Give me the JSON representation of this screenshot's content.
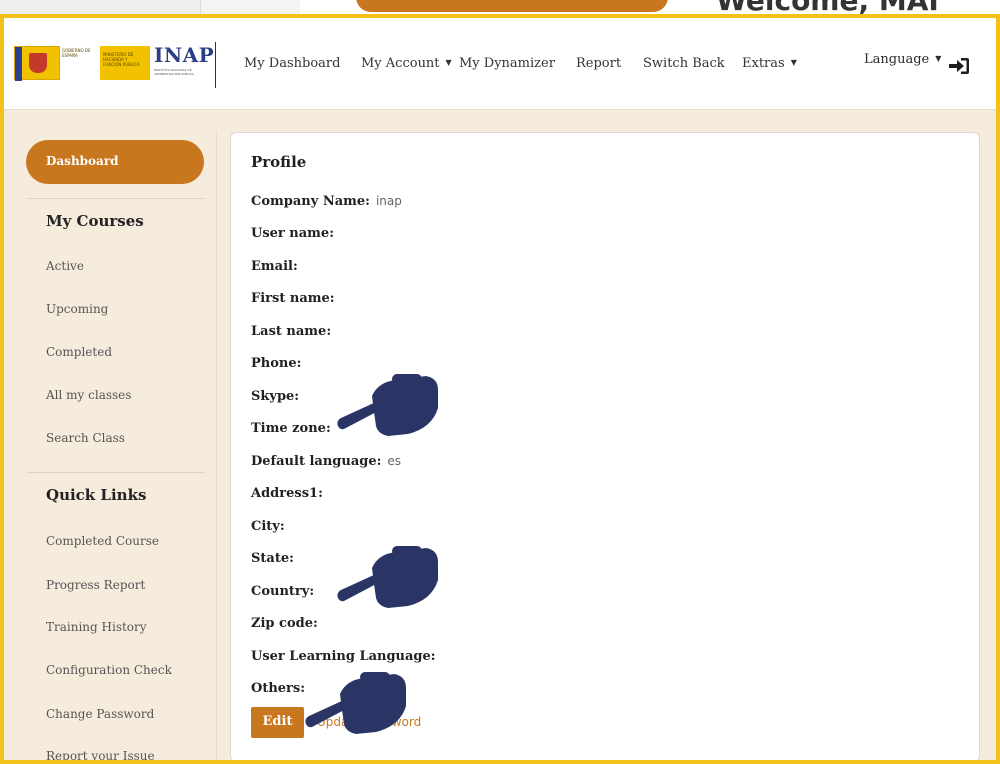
{
  "background": {
    "welcome_text": "Welcome, MAI"
  },
  "logo": {
    "gov_text": "Gobierno de España",
    "ministry_text": "Ministerio de Hacienda y Función Pública",
    "brand": "INAP",
    "brand_sub": "Instituto Nacional de Administración Pública"
  },
  "nav": {
    "items": [
      "My Dashboard",
      "My Account",
      "My Dynamizer",
      "Report",
      "Switch Back",
      "Extras"
    ],
    "language": "Language"
  },
  "sidebar": {
    "dashboard": "Dashboard",
    "my_courses_heading": "My Courses",
    "courses": [
      "Active",
      "Upcoming",
      "Completed",
      "All my classes",
      "Search Class"
    ],
    "quick_links_heading": "Quick Links",
    "quick_links": [
      "Completed Course",
      "Progress Report",
      "Training History",
      "Configuration Check",
      "Change Password",
      "Report your Issue"
    ]
  },
  "profile": {
    "title": "Profile",
    "fields": [
      {
        "label": "Company Name:",
        "value": "inap"
      },
      {
        "label": "User name:",
        "value": ""
      },
      {
        "label": "Email:",
        "value": ""
      },
      {
        "label": "First name:",
        "value": ""
      },
      {
        "label": "Last name:",
        "value": ""
      },
      {
        "label": "Phone:",
        "value": ""
      },
      {
        "label": "Skype:",
        "value": ""
      },
      {
        "label": "Time zone:",
        "value": ""
      },
      {
        "label": "Default language:",
        "value": "es"
      },
      {
        "label": "Address1:",
        "value": ""
      },
      {
        "label": "City:",
        "value": ""
      },
      {
        "label": "State:",
        "value": ""
      },
      {
        "label": "Country:",
        "value": ""
      },
      {
        "label": "Zip code:",
        "value": ""
      },
      {
        "label": "User Learning Language:",
        "value": ""
      },
      {
        "label": "Others:",
        "value": ""
      }
    ],
    "edit_label": "Edit",
    "update_password_label": "Update password"
  },
  "colors": {
    "accent": "#c9771f",
    "frame": "#f3c21a",
    "hand": "#2a3566",
    "page_bg": "#f6ecdd"
  }
}
